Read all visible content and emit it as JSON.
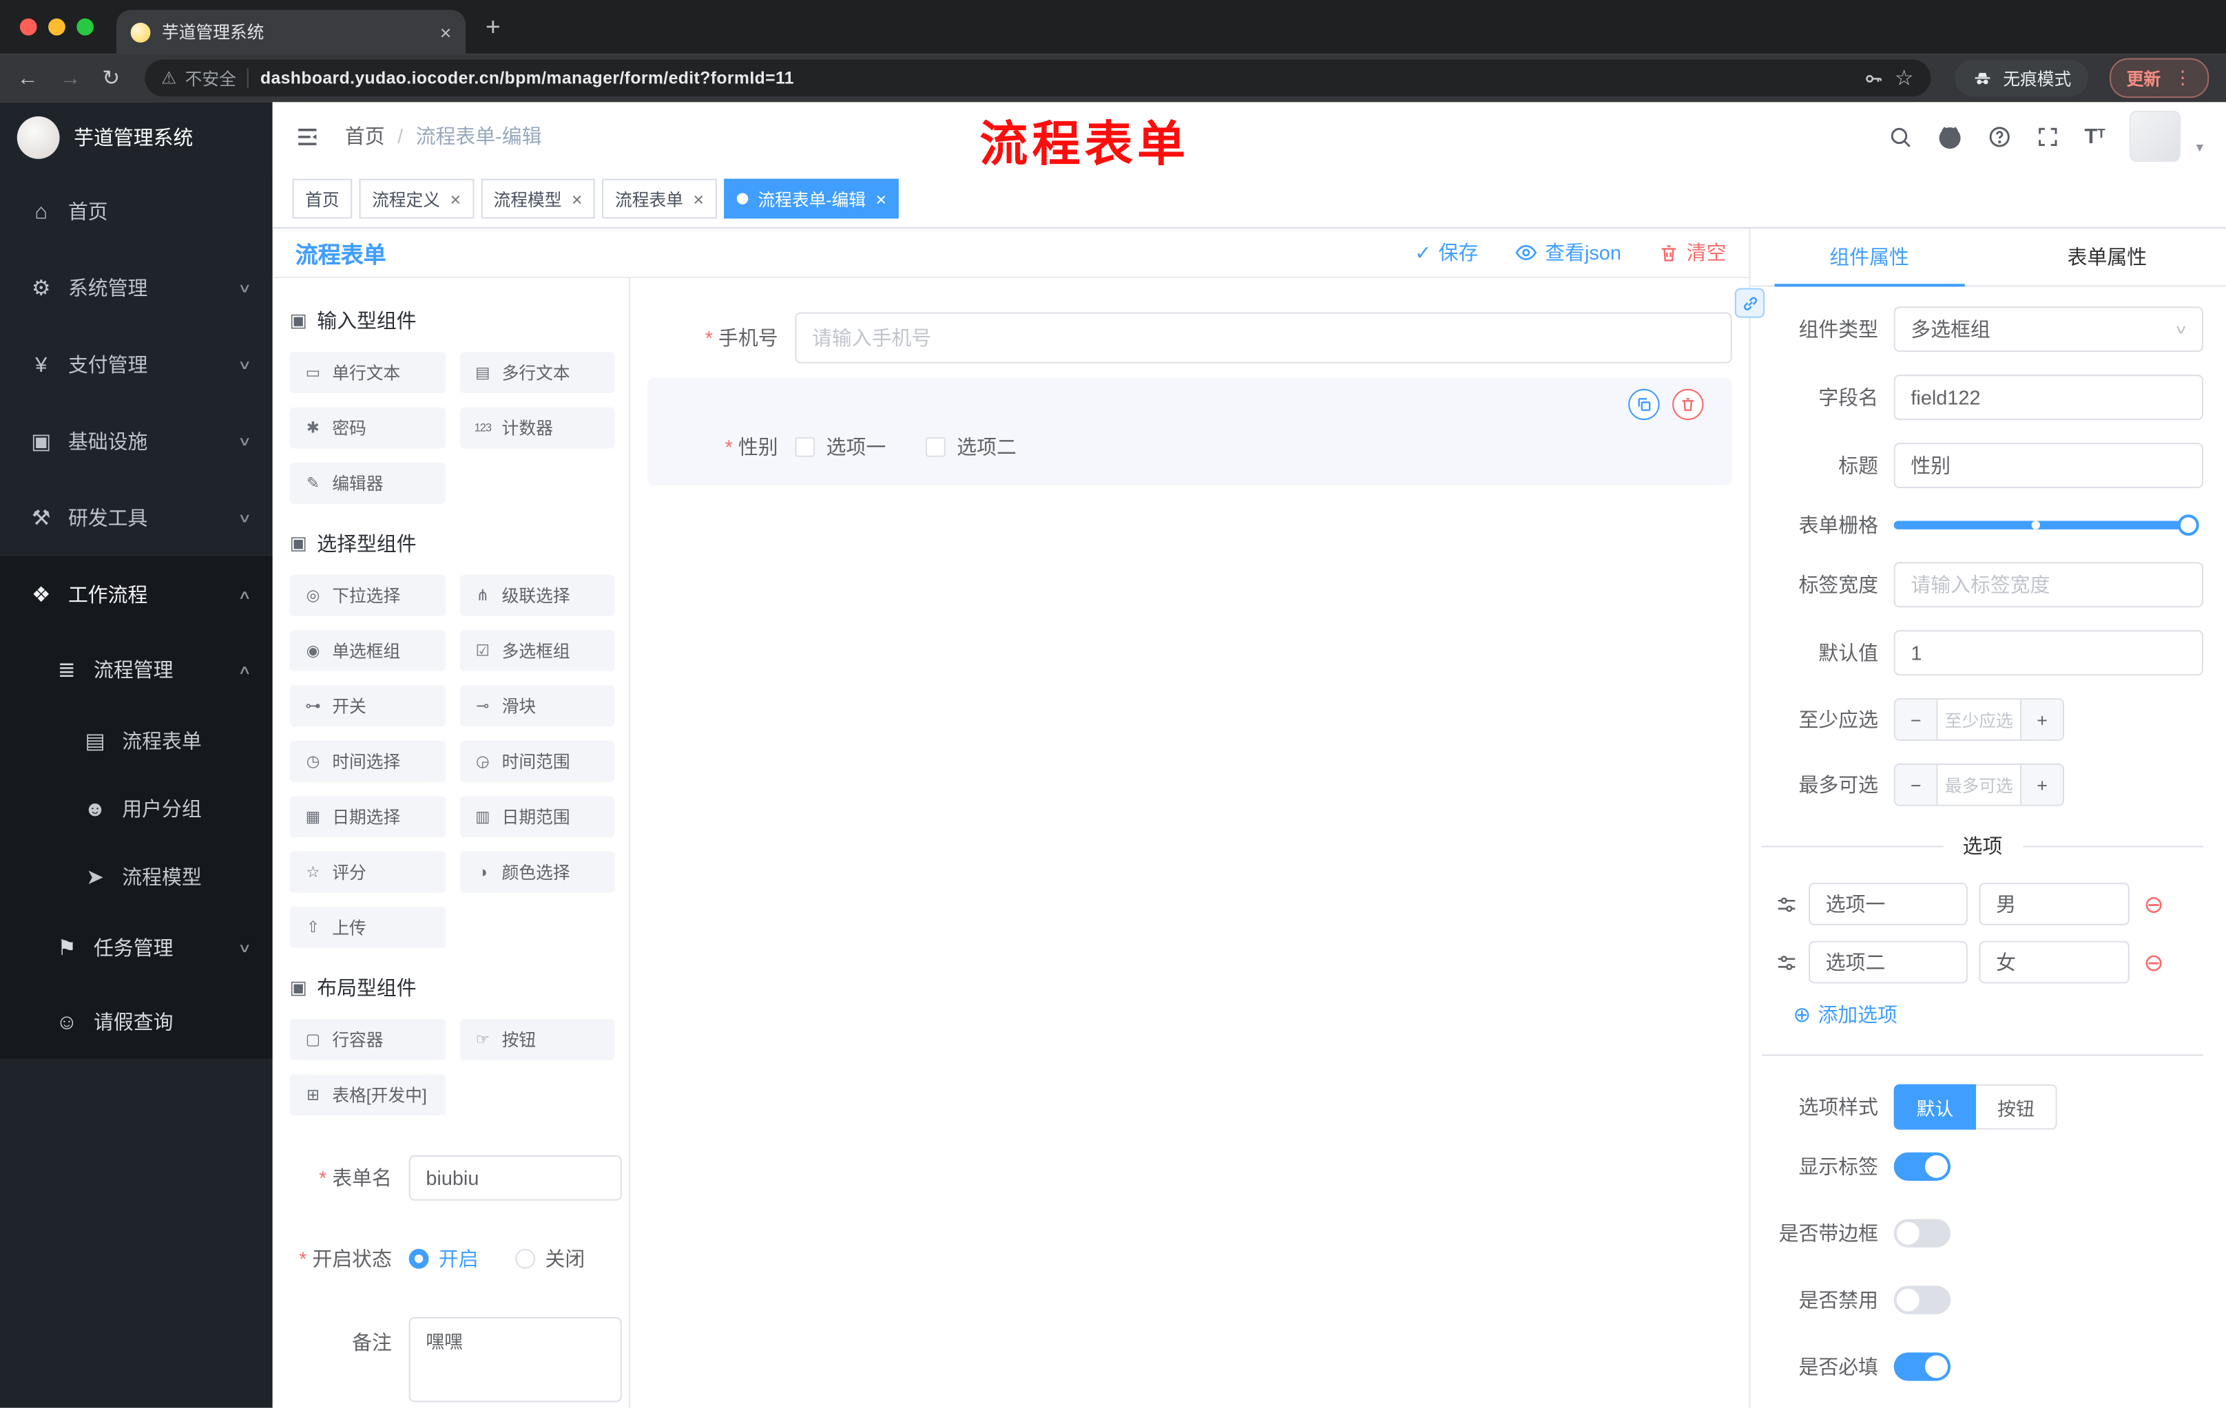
{
  "browser": {
    "tab_title": "芋道管理系统",
    "security_label": "不安全",
    "url": "dashboard.yudao.iocoder.cn/bpm/manager/form/edit?formId=11",
    "incognito_label": "无痕模式",
    "update_label": "更新"
  },
  "icons": {
    "back": "←",
    "forward": "→",
    "reload": "↻",
    "warning": "⚠",
    "star": "☆",
    "menu_dots": "⋮",
    "plus": "+",
    "close": "×",
    "home": "⌂",
    "gear": "⚙",
    "yen": "¥",
    "infra": "▣",
    "tools": "⚒",
    "workflow": "❖",
    "list": "≣",
    "doc": "▤",
    "users": "☻",
    "send": "➤",
    "task": "⚑",
    "person": "☺",
    "chev_down": "∨",
    "chev_up": "∧",
    "caret_down": "▾",
    "group": "▣",
    "comp_input": "▭",
    "comp_textarea": "▤",
    "comp_password": "✱",
    "comp_counter": "123",
    "comp_editor": "✎",
    "comp_select": "◎",
    "comp_cascader": "⋔",
    "comp_radio": "◉",
    "comp_checkbox": "☑",
    "comp_switch": "⊶",
    "comp_slider": "⊸",
    "comp_time": "◷",
    "comp_time_range": "◶",
    "comp_date": "▦",
    "comp_date_range": "▥",
    "comp_rate": "☆",
    "comp_color": "◑",
    "comp_upload": "⇧",
    "comp_row": "▢",
    "comp_button": "☞",
    "comp_table": "⊞",
    "check": "✓",
    "add_circle": "⊕",
    "remove_circle": "⊖"
  },
  "colors": {
    "primary": "#409eff",
    "danger": "#f56c6c",
    "annotation": "#fe0d0d"
  },
  "sidebar": {
    "logo_title": "芋道管理系统",
    "items": [
      {
        "label": "首页"
      },
      {
        "label": "系统管理"
      },
      {
        "label": "支付管理"
      },
      {
        "label": "基础设施"
      },
      {
        "label": "研发工具"
      },
      {
        "label": "工作流程"
      }
    ],
    "process_mgmt": {
      "label": "流程管理"
    },
    "children": [
      {
        "label": "流程表单"
      },
      {
        "label": "用户分组"
      },
      {
        "label": "流程模型"
      }
    ],
    "tail": [
      {
        "label": "任务管理"
      },
      {
        "label": "请假查询"
      }
    ]
  },
  "header": {
    "breadcrumb_home": "首页",
    "breadcrumb_sep": "/",
    "breadcrumb_current": "流程表单-编辑",
    "annotation": "流程表单"
  },
  "tags": {
    "items": [
      {
        "label": "首页"
      },
      {
        "label": "流程定义"
      },
      {
        "label": "流程模型"
      },
      {
        "label": "流程表单"
      },
      {
        "label": "流程表单-编辑"
      }
    ]
  },
  "designer": {
    "title": "流程表单",
    "save": "保存",
    "view_json": "查看json",
    "clear": "清空",
    "group1_title": "输入型组件",
    "group2_title": "选择型组件",
    "group3_title": "布局型组件",
    "palette1": [
      "单行文本",
      "多行文本",
      "密码",
      "计数器",
      "编辑器"
    ],
    "palette2": [
      "下拉选择",
      "级联选择",
      "单选框组",
      "多选框组",
      "开关",
      "滑块",
      "时间选择",
      "时间范围",
      "日期选择",
      "日期范围",
      "评分",
      "颜色选择",
      "上传"
    ],
    "palette3": [
      "行容器",
      "按钮",
      "表格[开发中]"
    ]
  },
  "form_meta": {
    "name_label": "表单名",
    "name_value": "biubiu",
    "status_label": "开启状态",
    "status_on": "开启",
    "status_off": "关闭",
    "remark_label": "备注",
    "remark_value": "嘿嘿"
  },
  "canvas": {
    "phone_label": "手机号",
    "phone_placeholder": "请输入手机号",
    "gender_label": "性别",
    "gender_opt1": "选项一",
    "gender_opt2": "选项二"
  },
  "props": {
    "tab_component": "组件属性",
    "tab_form": "表单属性",
    "type_label": "组件类型",
    "type_value": "多选框组",
    "field_label": "字段名",
    "field_value": "field122",
    "title_label": "标题",
    "title_value": "性别",
    "grid_label": "表单栅格",
    "width_label": "标签宽度",
    "width_placeholder": "请输入标签宽度",
    "default_label": "默认值",
    "default_value": "1",
    "min_label": "至少应选",
    "min_placeholder": "至少应选",
    "max_label": "最多可选",
    "max_placeholder": "最多可选",
    "options_title": "选项",
    "options": [
      {
        "label": "选项一",
        "value": "男"
      },
      {
        "label": "选项二",
        "value": "女"
      }
    ],
    "add_option": "添加选项",
    "style_label": "选项样式",
    "style_default": "默认",
    "style_button": "按钮",
    "toggle_show_label": "显示标签",
    "toggle_border": "是否带边框",
    "toggle_disabled": "是否禁用",
    "toggle_required": "是否必填"
  }
}
